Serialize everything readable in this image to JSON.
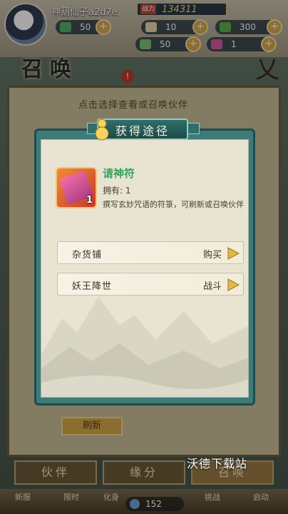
{
  "header": {
    "player_name": "神葫仙子a2d7e",
    "power_label": "战力",
    "power_value": "134311"
  },
  "resources": [
    {
      "icon": "jade-icon",
      "value": "50",
      "color": "#58b06a"
    },
    {
      "icon": "scroll-icon",
      "value": "10",
      "color": "#e8d8b0"
    },
    {
      "icon": "gem-icon",
      "value": "300",
      "color": "#5cb04c"
    },
    {
      "icon": "ticket-icon",
      "value": "50",
      "color": "#7ec07a"
    },
    {
      "icon": "talisman-icon",
      "value": "1",
      "color": "#d85aa0"
    }
  ],
  "page": {
    "title": "召唤",
    "close_glyph": "乂",
    "hint": "点击选择查看或召唤伙伴",
    "alert_badge": "!"
  },
  "modal": {
    "title": "获得途径",
    "item": {
      "name": "请神符",
      "count": "1",
      "owned": "拥有: 1",
      "description": "撰写玄妙咒语的符箓，可刷新或召唤伙伴"
    },
    "sources": [
      {
        "name": "杂货铺",
        "action": "购买"
      },
      {
        "name": "妖王降世",
        "action": "战斗"
      }
    ]
  },
  "bottom_tabs": [
    {
      "label": "伙伴"
    },
    {
      "label": "缘分"
    },
    {
      "label": "召唤"
    }
  ],
  "bottom_nav": [
    {
      "label": "新服"
    },
    {
      "label": "限时"
    },
    {
      "label": "化身"
    },
    {
      "label": "挑战"
    },
    {
      "label": "启动"
    }
  ],
  "coin_value": "152",
  "refresh_label": "刷新",
  "watermark": "沃德下载站",
  "colors": {
    "modal_frame": "#3d7a78",
    "item_name": "#3aa35c",
    "gold": "#d9a84a"
  }
}
